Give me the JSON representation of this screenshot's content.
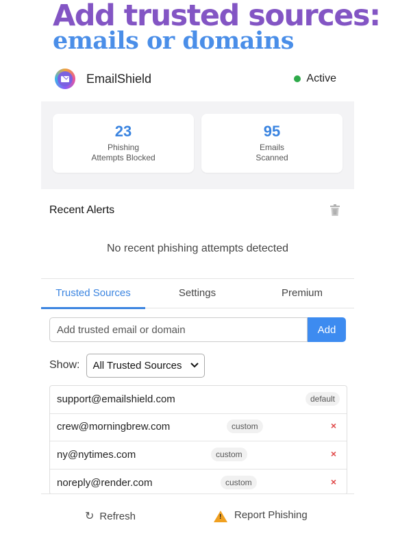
{
  "promo": {
    "line1": "Add trusted sources:",
    "line2": "emails or domains"
  },
  "app": {
    "name": "EmailShield",
    "status": "Active",
    "status_color": "#2eaa4a",
    "icon": "email-shield-logo"
  },
  "stats": [
    {
      "value": "23",
      "label_line1": "Phishing",
      "label_line2": "Attempts Blocked"
    },
    {
      "value": "95",
      "label_line1": "Emails",
      "label_line2": "Scanned"
    }
  ],
  "alerts": {
    "title": "Recent Alerts",
    "empty_message": "No recent phishing attempts detected",
    "clear_icon": "trash-icon"
  },
  "tabs": [
    {
      "label": "Trusted Sources",
      "active": true
    },
    {
      "label": "Settings",
      "active": false
    },
    {
      "label": "Premium",
      "active": false
    }
  ],
  "add_source": {
    "placeholder": "Add trusted email or domain",
    "value": "",
    "button_label": "Add"
  },
  "filter": {
    "label": "Show:",
    "selected": "All Trusted Sources"
  },
  "trusted_sources": [
    {
      "email": "support@emailshield.com",
      "type": "default",
      "removable": false
    },
    {
      "email": "crew@morningbrew.com",
      "type": "custom",
      "removable": true
    },
    {
      "email": "ny@nytimes.com",
      "type": "custom",
      "removable": true
    },
    {
      "email": "noreply@render.com",
      "type": "custom",
      "removable": true
    }
  ],
  "remove_glyph": "×",
  "footer": {
    "refresh_label": "Refresh",
    "refresh_icon": "refresh-icon",
    "report_label": "Report Phishing",
    "report_icon": "warning-icon"
  },
  "colors": {
    "accent": "#3a84e0",
    "promo_purple": "#8355c4",
    "promo_blue": "#4a8ee8",
    "remove_red": "#e04848",
    "warning": "#f0a020"
  }
}
